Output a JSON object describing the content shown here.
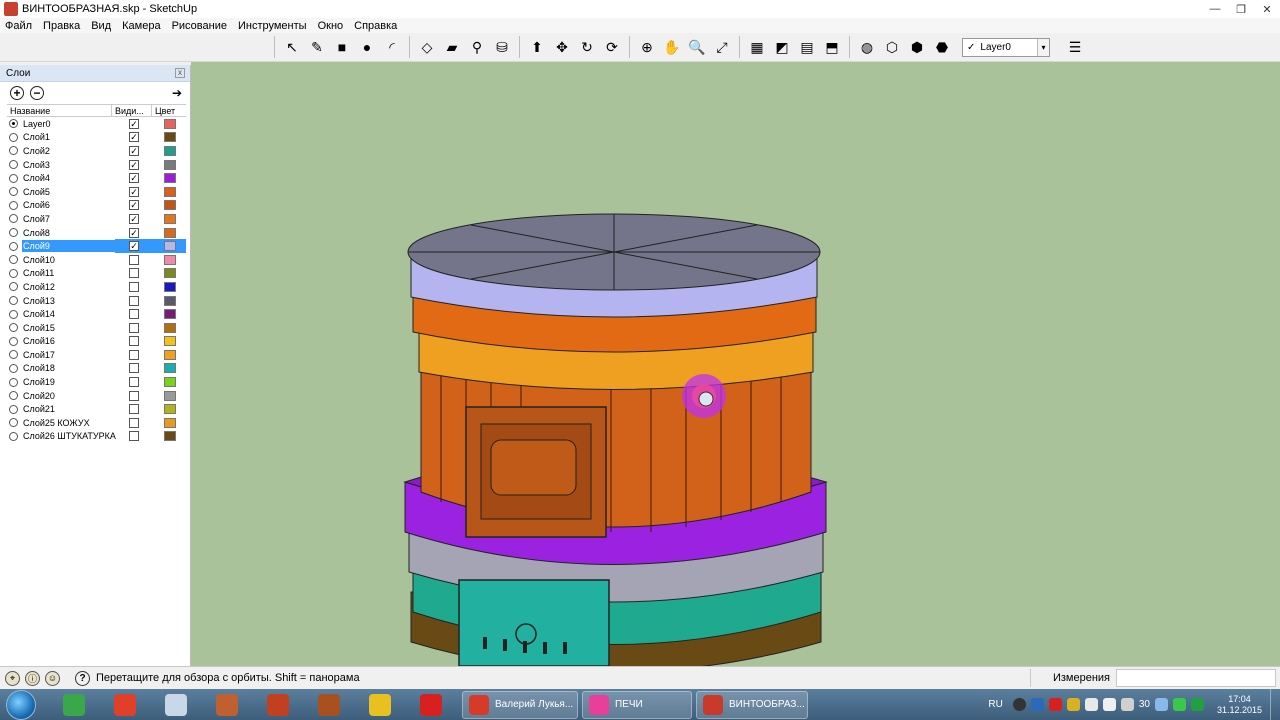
{
  "window": {
    "title": "ВИНТООБРАЗНАЯ.skp - SketchUp",
    "minimize": "—",
    "maximize": "❐",
    "close": "✕"
  },
  "menu": [
    "Файл",
    "Правка",
    "Вид",
    "Камера",
    "Рисование",
    "Инструменты",
    "Окно",
    "Справка"
  ],
  "toolbar": {
    "tools": [
      {
        "icon": "select-arrow-icon",
        "glyph": "↖"
      },
      {
        "icon": "pencil-icon",
        "glyph": "✎"
      },
      {
        "icon": "rectangle-icon",
        "glyph": "■"
      },
      {
        "icon": "circle-icon",
        "glyph": "●"
      },
      {
        "icon": "arc-icon",
        "glyph": "◜"
      },
      {
        "icon": "make-component-icon",
        "glyph": "◇"
      },
      {
        "icon": "eraser-icon",
        "glyph": "▰"
      },
      {
        "icon": "tape-measure-icon",
        "glyph": "⚲"
      },
      {
        "icon": "paint-bucket-icon",
        "glyph": "⛁"
      },
      {
        "icon": "push-pull-icon",
        "glyph": "⬆"
      },
      {
        "icon": "move-icon",
        "glyph": "✥"
      },
      {
        "icon": "rotate-icon",
        "glyph": "↻"
      },
      {
        "icon": "offset-icon",
        "glyph": "⟳"
      },
      {
        "icon": "orbit-icon",
        "glyph": "⊕"
      },
      {
        "icon": "pan-hand-icon",
        "glyph": "✋"
      },
      {
        "icon": "zoom-icon",
        "glyph": "🔍"
      },
      {
        "icon": "zoom-extents-icon",
        "glyph": "⤢"
      },
      {
        "icon": "add-location-icon",
        "glyph": "▦"
      },
      {
        "icon": "toggle-terrain-icon",
        "glyph": "◩"
      },
      {
        "icon": "photo-textures-icon",
        "glyph": "▤"
      },
      {
        "icon": "preview-google-earth-icon",
        "glyph": "⬒"
      },
      {
        "icon": "get-models-icon",
        "glyph": "◍"
      },
      {
        "icon": "share-model-icon",
        "glyph": "⬡"
      },
      {
        "icon": "share-component-icon",
        "glyph": "⬢"
      },
      {
        "icon": "extension-warehouse-icon",
        "glyph": "⬣"
      }
    ],
    "layer_value": "Layer0",
    "layer_checkmark": "✓",
    "layer_dropdown": "▾",
    "layer_manager_glyph": "☰"
  },
  "layers_panel": {
    "title": "Слои",
    "close": "x",
    "add": "+",
    "remove": "−",
    "details": "➔",
    "columns": {
      "name": "Название",
      "visible": "Види...",
      "color": "Цвет"
    },
    "rows": [
      {
        "name": "Layer0",
        "active": true,
        "visible": true,
        "color": "#e8625c"
      },
      {
        "name": "Слой1",
        "active": false,
        "visible": true,
        "color": "#6b4a12"
      },
      {
        "name": "Слой2",
        "active": false,
        "visible": true,
        "color": "#1f9e8e"
      },
      {
        "name": "Слой3",
        "active": false,
        "visible": true,
        "color": "#7a7a7a"
      },
      {
        "name": "Слой4",
        "active": false,
        "visible": true,
        "color": "#9b1fd6"
      },
      {
        "name": "Слой5",
        "active": false,
        "visible": true,
        "color": "#d9611a"
      },
      {
        "name": "Слой6",
        "active": false,
        "visible": true,
        "color": "#c25512"
      },
      {
        "name": "Слой7",
        "active": false,
        "visible": true,
        "color": "#e3771c"
      },
      {
        "name": "Слой8",
        "active": false,
        "visible": true,
        "color": "#d96a1a"
      },
      {
        "name": "Слой9",
        "active": false,
        "visible": true,
        "color": "#b6b6ea",
        "selected": true
      },
      {
        "name": "Слой10",
        "active": false,
        "visible": false,
        "color": "#f08aa8"
      },
      {
        "name": "Слой11",
        "active": false,
        "visible": false,
        "color": "#7a8a1e"
      },
      {
        "name": "Слой12",
        "active": false,
        "visible": false,
        "color": "#1a1ac2"
      },
      {
        "name": "Слой13",
        "active": false,
        "visible": false,
        "color": "#5a5a6a"
      },
      {
        "name": "Слой14",
        "active": false,
        "visible": false,
        "color": "#7a1a7a"
      },
      {
        "name": "Слой15",
        "active": false,
        "visible": false,
        "color": "#b07012"
      },
      {
        "name": "Слой16",
        "active": false,
        "visible": false,
        "color": "#f2c21a"
      },
      {
        "name": "Слой17",
        "active": false,
        "visible": false,
        "color": "#f2a21a"
      },
      {
        "name": "Слой18",
        "active": false,
        "visible": false,
        "color": "#1aaeb2"
      },
      {
        "name": "Слой19",
        "active": false,
        "visible": false,
        "color": "#7ad21a"
      },
      {
        "name": "Слой20",
        "active": false,
        "visible": false,
        "color": "#9a9a9a"
      },
      {
        "name": "Слой21",
        "active": false,
        "visible": false,
        "color": "#b2b21a"
      },
      {
        "name": "Слой25 КОЖУХ",
        "active": false,
        "visible": false,
        "color": "#e89a1a"
      },
      {
        "name": "Слой26 ШТУКАТУРКА",
        "active": false,
        "visible": false,
        "color": "#6a4a12"
      }
    ]
  },
  "statusbar": {
    "message": "Перетащите для обзора с орбиты.  Shift = панорама",
    "help": "?",
    "measure_label": "Измерения",
    "icons": [
      "geo-location-icon",
      "credits-icon",
      "user-icon"
    ]
  },
  "taskbar": {
    "pinned": [
      {
        "name": "taskbar-app-green",
        "color": "#3aa84a"
      },
      {
        "name": "taskbar-app-office",
        "color": "#e0402a"
      },
      {
        "name": "taskbar-app-tool",
        "color": "#c8d8e8"
      },
      {
        "name": "taskbar-app-star",
        "color": "#c06030"
      },
      {
        "name": "taskbar-app-medal",
        "color": "#c04020"
      },
      {
        "name": "taskbar-app-badge",
        "color": "#a85020"
      },
      {
        "name": "taskbar-app-chrome",
        "color": "#e8c020"
      },
      {
        "name": "taskbar-app-opera",
        "color": "#d82020"
      }
    ],
    "tasks": [
      {
        "label": "Валерий Лукья...",
        "color": "#d83a2a"
      },
      {
        "label": "ПЕЧИ",
        "color": "#e8409a"
      },
      {
        "label": "ВИНТООБРАЗ...",
        "color": "#c83a2a"
      }
    ],
    "lang": "RU",
    "tray_number": "30",
    "time": "17:04",
    "date": "31.12.2015"
  },
  "colors": {
    "viewport_bg": "#a9c29a",
    "selection": "#3399ff"
  }
}
